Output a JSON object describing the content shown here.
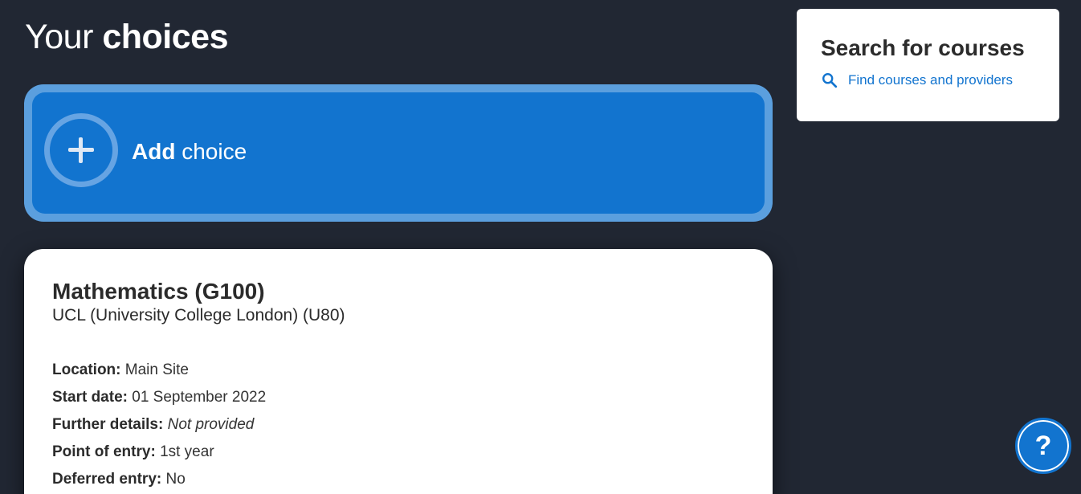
{
  "page": {
    "title_regular": "Your ",
    "title_bold": "choices"
  },
  "add_choice": {
    "label_bold": "Add",
    "label_regular": " choice"
  },
  "choice": {
    "course": "Mathematics (G100)",
    "provider": "UCL (University College London) (U80)",
    "details": [
      {
        "label": "Location:",
        "value": "Main Site"
      },
      {
        "label": "Start date:",
        "value": "01 September 2022"
      },
      {
        "label": "Further details:",
        "value": "Not provided"
      },
      {
        "label": "Point of entry:",
        "value": "1st year"
      },
      {
        "label": "Deferred entry:",
        "value": "No"
      }
    ]
  },
  "search": {
    "title": "Search for courses",
    "link_label": "Find courses and providers",
    "icon": "search-icon"
  },
  "help": {
    "label": "?"
  },
  "colors": {
    "background": "#212733",
    "accent": "#1274cf",
    "accent_border": "#5b9fde",
    "card": "#ffffff"
  }
}
